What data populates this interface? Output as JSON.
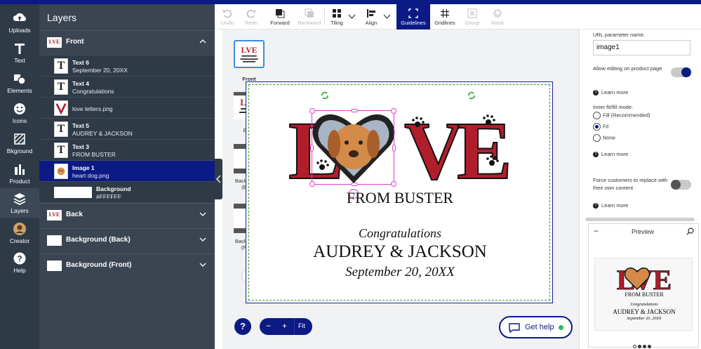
{
  "rail": [
    {
      "label": "Uploads",
      "icon": "cloud-upload-icon"
    },
    {
      "label": "Text",
      "icon": "text-icon"
    },
    {
      "label": "Elements",
      "icon": "elements-icon"
    },
    {
      "label": "Icons",
      "icon": "smiley-icon"
    },
    {
      "label": "Bkground",
      "icon": "background-icon"
    },
    {
      "label": "Product",
      "icon": "product-icon"
    },
    {
      "label": "Layers",
      "icon": "layers-icon"
    },
    {
      "label": "Creator",
      "icon": "creator-icon"
    },
    {
      "label": "Help",
      "icon": "help-icon"
    }
  ],
  "layers_panel": {
    "title": "Layers",
    "front": {
      "title": "Front",
      "items": [
        {
          "name": "Text 6",
          "sub": "September 20, 20XX",
          "type": "text"
        },
        {
          "name": "Text 4",
          "sub": "Congratulations",
          "type": "text"
        },
        {
          "name": "",
          "sub": "love letters.png",
          "type": "image"
        },
        {
          "name": "Text 5",
          "sub": "AUDREY & JACKSON",
          "type": "text"
        },
        {
          "name": "Text 3",
          "sub": "FROM BUSTER",
          "type": "text"
        },
        {
          "name": "Image 1",
          "sub": "heart dog.png",
          "type": "image",
          "selected": true
        },
        {
          "name": "Background",
          "sub": "#FFFFFF",
          "type": "background"
        }
      ]
    },
    "groups": [
      "Back",
      "Background (Back)",
      "Background (Front)"
    ]
  },
  "toolbar": {
    "items": [
      {
        "label": "Undo",
        "state": "disabled"
      },
      {
        "label": "Redo",
        "state": "disabled"
      },
      {
        "label": "Forward",
        "state": "normal"
      },
      {
        "label": "Backward",
        "state": "disabled"
      },
      {
        "label": "Tiling",
        "state": "normal"
      },
      {
        "label": "Align",
        "state": "normal"
      },
      {
        "label": "Guidelines",
        "state": "active"
      },
      {
        "label": "Gridlines",
        "state": "normal"
      },
      {
        "label": "Group",
        "state": "disabled"
      },
      {
        "label": "Mask",
        "state": "disabled"
      }
    ]
  },
  "pages": [
    {
      "label": "Front",
      "active": true
    },
    {
      "label": "Back",
      "active": false
    },
    {
      "label": "Background (Back)",
      "active": false
    },
    {
      "label": "Background (Front)",
      "active": false
    }
  ],
  "card": {
    "love": "LOVE",
    "from": "FROM BUSTER",
    "congrats": "Congratulations",
    "names": "AUDREY & JACKSON",
    "date": "September 20, 20XX"
  },
  "zoom": {
    "minus": "−",
    "plus": "+",
    "fit": "Fit"
  },
  "help_label": "?",
  "get_help": "Get help",
  "right_panel": {
    "url_param_label": "URL parameter name:",
    "url_param_value": "image1",
    "allow_editing": "Allow editing on product page",
    "learn_more": "Learn more",
    "inner_fit_label": "Inner fit/fill mode:",
    "fit_options": [
      {
        "label": "Fill (Recommended)",
        "selected": false
      },
      {
        "label": "Fit",
        "selected": true
      },
      {
        "label": "None",
        "selected": false
      }
    ],
    "force_replace": "Force customers to replace with their own content",
    "preview_title": "Preview",
    "preview_minus": "−"
  },
  "colors": {
    "accent": "#0b1a84",
    "rail": "#2f3a47",
    "panel": "#3b4552",
    "love_red": "#b11e2b",
    "guide_green": "#29a229"
  }
}
